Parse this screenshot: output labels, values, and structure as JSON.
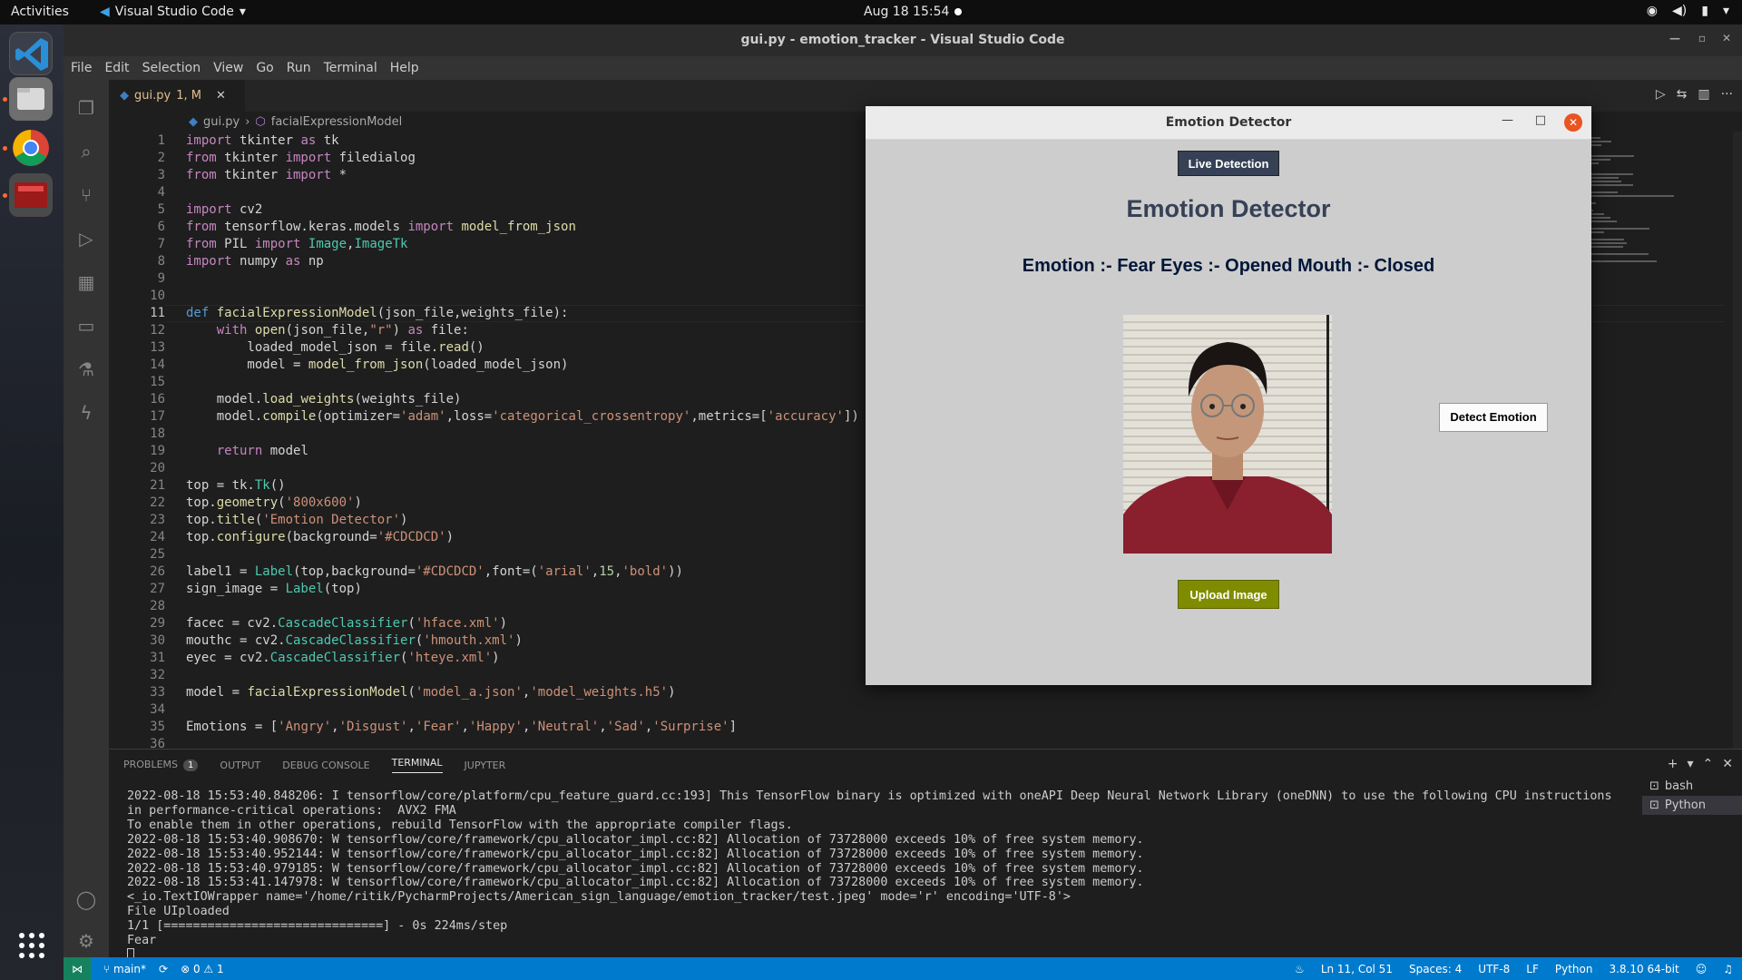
{
  "topbar": {
    "activities": "Activities",
    "app_name": "Visual Studio Code",
    "clock": "Aug 18  15:54"
  },
  "window": {
    "title": "gui.py - emotion_tracker - Visual Studio Code"
  },
  "menu": [
    "File",
    "Edit",
    "Selection",
    "View",
    "Go",
    "Run",
    "Terminal",
    "Help"
  ],
  "tab": {
    "label": "gui.py",
    "status": "1, M"
  },
  "breadcrumb": {
    "file": "gui.py",
    "symbol": "facialExpressionModel"
  },
  "editor": {
    "current_line": 11,
    "lines": [
      "import tkinter as tk",
      "from tkinter import filedialog",
      "from tkinter import *",
      "",
      "import cv2",
      "from tensorflow.keras.models import model_from_json",
      "from PIL import Image,ImageTk",
      "import numpy as np",
      "",
      "",
      "def facialExpressionModel(json_file,weights_file):",
      "    with open(json_file,\"r\") as file:",
      "        loaded_model_json = file.read()",
      "        model = model_from_json(loaded_model_json)",
      "",
      "    model.load_weights(weights_file)",
      "    model.compile(optimizer='adam',loss='categorical_crossentropy',metrics=['accuracy'])",
      "",
      "    return model",
      "",
      "top = tk.Tk()",
      "top.geometry('800x600')",
      "top.title('Emotion Detector')",
      "top.configure(background='#CDCDCD')",
      "",
      "label1 = Label(top,background='#CDCDCD',font=('arial',15,'bold'))",
      "sign_image = Label(top)",
      "",
      "facec = cv2.CascadeClassifier('hface.xml')",
      "mouthc = cv2.CascadeClassifier('hmouth.xml')",
      "eyec = cv2.CascadeClassifier('hteye.xml')",
      "",
      "model = facialExpressionModel('model_a.json','model_weights.h5')",
      "",
      "Emotions = ['Angry','Disgust','Fear','Happy','Neutral','Sad','Surprise']",
      ""
    ]
  },
  "panel": {
    "tabs": [
      {
        "label": "PROBLEMS",
        "badge": "1"
      },
      {
        "label": "OUTPUT"
      },
      {
        "label": "DEBUG CONSOLE"
      },
      {
        "label": "TERMINAL"
      },
      {
        "label": "JUPYTER"
      }
    ],
    "terminal_lines": [
      "2022-08-18 15:53:40.848206: I tensorflow/core/platform/cpu_feature_guard.cc:193] This TensorFlow binary is optimized with oneAPI Deep Neural Network Library (oneDNN) to use the following CPU instructions in performance-critical operations:  AVX2 FMA",
      "To enable them in other operations, rebuild TensorFlow with the appropriate compiler flags.",
      "2022-08-18 15:53:40.908670: W tensorflow/core/framework/cpu_allocator_impl.cc:82] Allocation of 73728000 exceeds 10% of free system memory.",
      "2022-08-18 15:53:40.952144: W tensorflow/core/framework/cpu_allocator_impl.cc:82] Allocation of 73728000 exceeds 10% of free system memory.",
      "2022-08-18 15:53:40.979185: W tensorflow/core/framework/cpu_allocator_impl.cc:82] Allocation of 73728000 exceeds 10% of free system memory.",
      "2022-08-18 15:53:41.147978: W tensorflow/core/framework/cpu_allocator_impl.cc:82] Allocation of 73728000 exceeds 10% of free system memory.",
      "<_io.TextIOWrapper name='/home/ritik/PycharmProjects/American_sign_language/emotion_tracker/test.jpeg' mode='r' encoding='UTF-8'>",
      "File UIploaded",
      "1/1 [==============================] - 0s 224ms/step",
      "Fear"
    ],
    "terminals": [
      "bash",
      "Python"
    ]
  },
  "status": {
    "branch": "main*",
    "errors": "0",
    "warnings": "1",
    "position": "Ln 11, Col 51",
    "spaces": "Spaces: 4",
    "encoding": "UTF-8",
    "eol": "LF",
    "language": "Python",
    "interpreter": "3.8.10 64-bit"
  },
  "app": {
    "title": "Emotion Detector",
    "live_label": "Live Detection",
    "heading": "Emotion Detector",
    "result": "Emotion :- Fear Eyes :- Opened Mouth :- Closed",
    "detect_label": "Detect Emotion",
    "upload_label": "Upload Image"
  },
  "colors": {
    "accent": "#007acc",
    "tk_bg": "#CDCDCD",
    "live_btn": "#364156",
    "upload_btn": "#7f8c00"
  }
}
